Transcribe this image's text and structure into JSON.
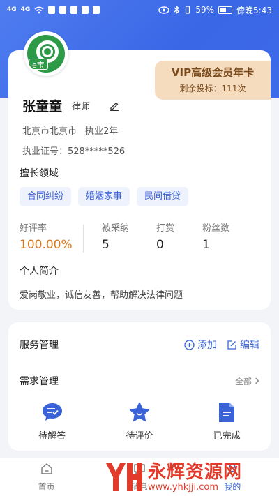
{
  "status_bar": {
    "signal_left": "4G",
    "signal_right": "4G",
    "battery_pct": "59%",
    "time": "傍晚5:43"
  },
  "profile": {
    "avatar_badge": "e宝",
    "vip_title": "VIP高级会员年卡",
    "vip_remaining": "剩余投标：111次",
    "name": "张童童",
    "role": "律师",
    "location": "北京市北京市",
    "experience": "执业2年",
    "license": "执业证号：528*****526",
    "skills_title": "擅长领域",
    "skills": [
      "合同纠纷",
      "婚姻家事",
      "民间借贷"
    ],
    "stats": [
      {
        "label": "好评率",
        "value": "100.00%"
      },
      {
        "label": "被采纳",
        "value": "5"
      },
      {
        "label": "打赏",
        "value": "0"
      },
      {
        "label": "粉丝数",
        "value": "1"
      }
    ],
    "intro_title": "个人简介",
    "intro_text": "爱岗敬业，诚信友善，帮助解决法律问题"
  },
  "service": {
    "title": "服务管理",
    "add_label": "添加",
    "edit_label": "编辑",
    "req_title": "需求管理",
    "all_label": "全部",
    "req_items": [
      {
        "label": "待解答",
        "icon": "chat-check-icon"
      },
      {
        "label": "待评价",
        "icon": "star-smile-icon"
      },
      {
        "label": "已完成",
        "icon": "document-icon"
      }
    ]
  },
  "tabbar": {
    "items": [
      {
        "label": "首页",
        "icon": "home-icon"
      },
      {
        "label": "消息",
        "icon": "message-icon"
      },
      {
        "label": "我的",
        "icon": "profile-icon"
      }
    ]
  },
  "watermark": {
    "text": "永辉资源网",
    "url": "www.yhkjji.com"
  },
  "colors": {
    "header_blue": "#3d6ae8",
    "accent_blue": "#3b63d8",
    "rate_orange": "#d9771d",
    "vip_bg": "#f6dcbf",
    "watermark_red": "#e23b2b"
  }
}
